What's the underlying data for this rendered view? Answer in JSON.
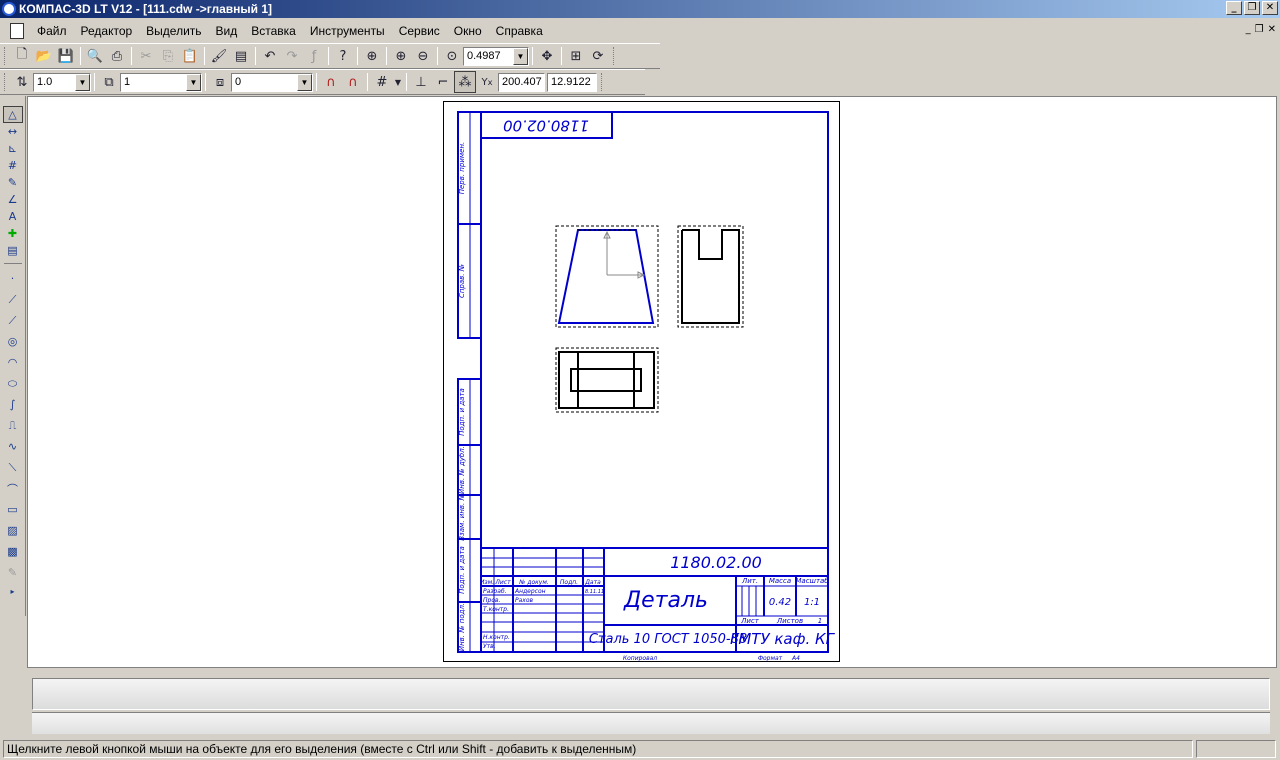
{
  "window": {
    "title": "КОМПАС-3D LT V12 - [111.cdw ->главный 1]"
  },
  "menu": {
    "items": [
      {
        "label": "Файл"
      },
      {
        "label": "Редактор"
      },
      {
        "label": "Выделить"
      },
      {
        "label": "Вид"
      },
      {
        "label": "Вставка"
      },
      {
        "label": "Инструменты"
      },
      {
        "label": "Сервис"
      },
      {
        "label": "Окно"
      },
      {
        "label": "Справка"
      }
    ]
  },
  "toolbar": {
    "zoom_value": "0.4987",
    "line_scale": "1.0",
    "view_number": "1",
    "layer_number": "0",
    "coord_x": "200.407",
    "coord_y": "12.9122"
  },
  "drawing": {
    "top_stamp": "1180.02.00",
    "designation": "1180.02.00",
    "part_name": "Деталь",
    "material": "Сталь 10  ГОСТ 1050-88",
    "organization": "ГМТУ каф. КГ",
    "mass": "0.42",
    "scale": "1:1",
    "sheet_label": "Лист",
    "sheets_label": "Листов",
    "sheets_count": "1",
    "lit_label": "Лит.",
    "mass_label": "Масса",
    "scale_label": "Масштаб",
    "header_izm": "Изм.",
    "header_list": "Лист",
    "header_doc": "№ докум.",
    "header_sign": "Подп.",
    "header_date": "Дата",
    "row_razrab": "Разраб.",
    "row_prov": "Пров.",
    "row_tkontr": "Т.контр.",
    "row_nkontr": "Н.контр.",
    "row_utv": "Утв.",
    "razrab_name": "Андерсон",
    "prov_name": "Рахов",
    "razrab_date": "8.11.11",
    "copied_label": "Копировал",
    "format_label": "Формат",
    "format_value": "A4",
    "side_perv": "Перв. примен.",
    "side_sprav": "Справ. №",
    "side_podp1": "Подп. и дата",
    "side_inv_dubl": "Инв. № дубл.",
    "side_vzam": "Взам. инв. №",
    "side_podp2": "Подп. и дата",
    "side_inv_podl": "Инв. № подл."
  },
  "status": {
    "message": "Щелкните левой кнопкой мыши на объекте для его выделения (вместе с Ctrl или Shift - добавить к выделенным)"
  }
}
